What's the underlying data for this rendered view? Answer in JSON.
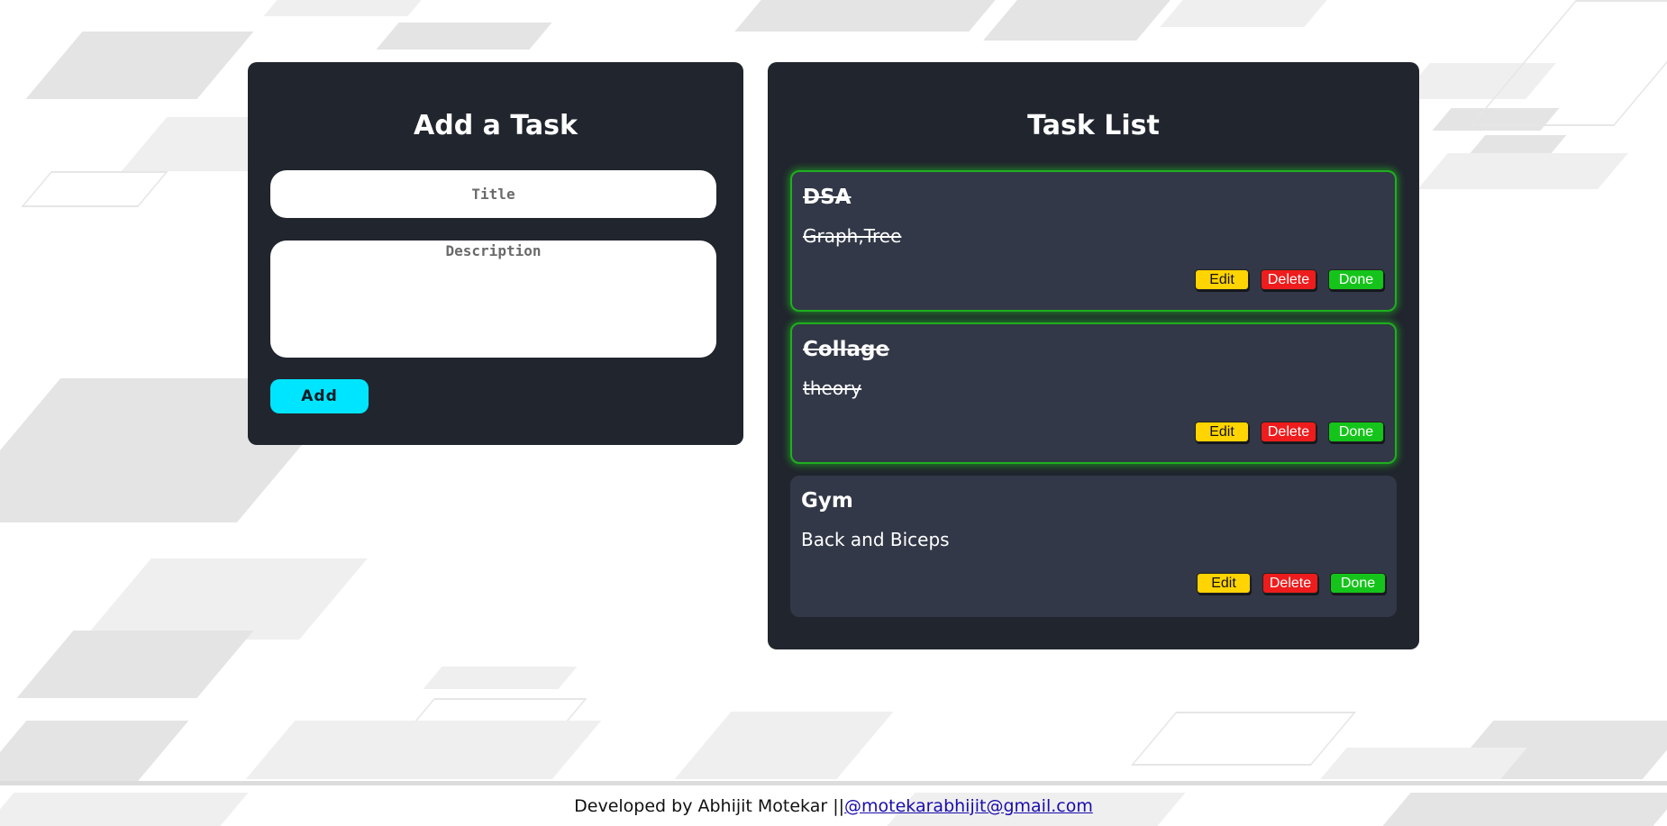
{
  "add_panel": {
    "title": "Add a Task",
    "title_placeholder": "Title",
    "description_placeholder": "Description",
    "title_value": "",
    "description_value": "",
    "add_label": "Add"
  },
  "list_panel": {
    "title": "Task List",
    "tasks": [
      {
        "title": "DSA",
        "description": "Graph,Tree",
        "done": true,
        "edit_label": "Edit",
        "delete_label": "Delete",
        "done_label": "Done"
      },
      {
        "title": "Collage",
        "description": "theory",
        "done": true,
        "edit_label": "Edit",
        "delete_label": "Delete",
        "done_label": "Done"
      },
      {
        "title": "Gym",
        "description": "Back and Biceps",
        "done": false,
        "edit_label": "Edit",
        "delete_label": "Delete",
        "done_label": "Done"
      }
    ]
  },
  "footer": {
    "text": "Developed by Abhijit Motekar ||",
    "email": "@motekarabhijit@gmail.com"
  },
  "colors": {
    "panel_bg": "#21252e",
    "card_bg": "#323847",
    "add_button": "#00e5ff",
    "edit_button": "#ffd400",
    "delete_button": "#ee1c1c",
    "done_button": "#15c41a",
    "done_glow": "#1fae1f"
  }
}
